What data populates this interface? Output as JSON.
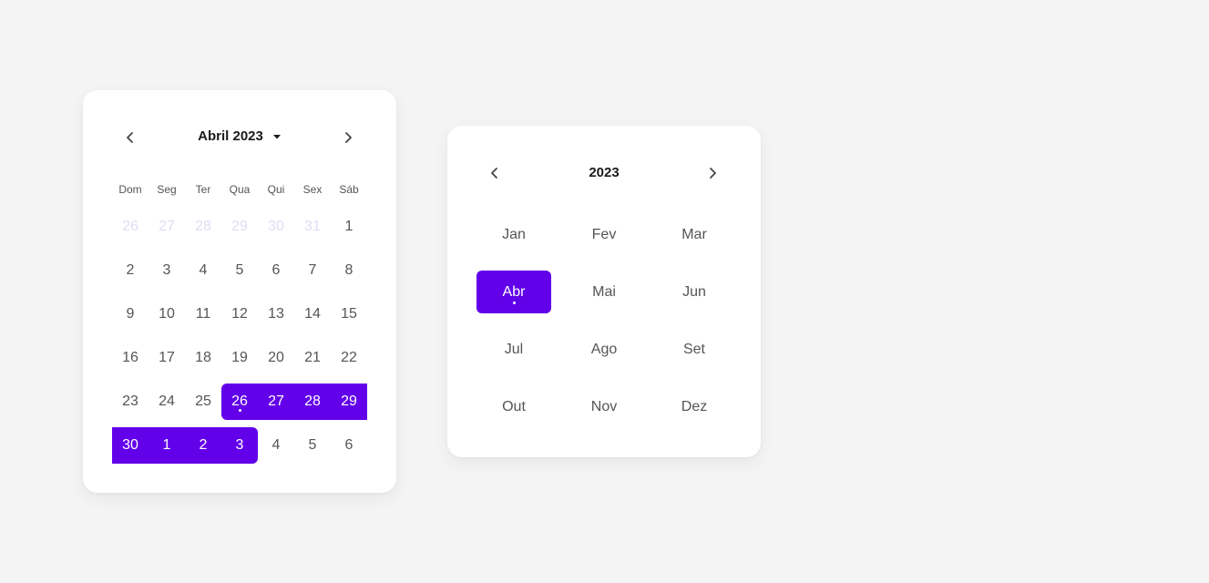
{
  "day_picker": {
    "title": "Abril 2023",
    "weekdays": [
      "Dom",
      "Seg",
      "Ter",
      "Qua",
      "Qui",
      "Sex",
      "Sáb"
    ],
    "days": [
      {
        "label": "26",
        "state": "muted"
      },
      {
        "label": "27",
        "state": "muted"
      },
      {
        "label": "28",
        "state": "muted"
      },
      {
        "label": "29",
        "state": "muted"
      },
      {
        "label": "30",
        "state": "muted"
      },
      {
        "label": "31",
        "state": "muted"
      },
      {
        "label": "1",
        "state": "normal"
      },
      {
        "label": "2",
        "state": "normal"
      },
      {
        "label": "3",
        "state": "normal"
      },
      {
        "label": "4",
        "state": "normal"
      },
      {
        "label": "5",
        "state": "normal"
      },
      {
        "label": "6",
        "state": "normal"
      },
      {
        "label": "7",
        "state": "normal"
      },
      {
        "label": "8",
        "state": "normal"
      },
      {
        "label": "9",
        "state": "normal"
      },
      {
        "label": "10",
        "state": "normal"
      },
      {
        "label": "11",
        "state": "normal"
      },
      {
        "label": "12",
        "state": "normal"
      },
      {
        "label": "13",
        "state": "normal"
      },
      {
        "label": "14",
        "state": "normal"
      },
      {
        "label": "15",
        "state": "normal"
      },
      {
        "label": "16",
        "state": "normal"
      },
      {
        "label": "17",
        "state": "normal"
      },
      {
        "label": "18",
        "state": "normal"
      },
      {
        "label": "19",
        "state": "normal"
      },
      {
        "label": "20",
        "state": "normal"
      },
      {
        "label": "21",
        "state": "normal"
      },
      {
        "label": "22",
        "state": "normal"
      },
      {
        "label": "23",
        "state": "normal"
      },
      {
        "label": "24",
        "state": "normal"
      },
      {
        "label": "25",
        "state": "normal"
      },
      {
        "label": "26",
        "state": "range-start",
        "today": true
      },
      {
        "label": "27",
        "state": "range"
      },
      {
        "label": "28",
        "state": "range"
      },
      {
        "label": "29",
        "state": "range"
      },
      {
        "label": "30",
        "state": "range"
      },
      {
        "label": "1",
        "state": "range"
      },
      {
        "label": "2",
        "state": "range"
      },
      {
        "label": "3",
        "state": "range-end"
      },
      {
        "label": "4",
        "state": "normal"
      },
      {
        "label": "5",
        "state": "normal"
      },
      {
        "label": "6",
        "state": "normal"
      }
    ]
  },
  "month_picker": {
    "year": "2023",
    "months": [
      {
        "label": "Jan",
        "selected": false
      },
      {
        "label": "Fev",
        "selected": false
      },
      {
        "label": "Mar",
        "selected": false
      },
      {
        "label": "Abr",
        "selected": true
      },
      {
        "label": "Mai",
        "selected": false
      },
      {
        "label": "Jun",
        "selected": false
      },
      {
        "label": "Jul",
        "selected": false
      },
      {
        "label": "Ago",
        "selected": false
      },
      {
        "label": "Set",
        "selected": false
      },
      {
        "label": "Out",
        "selected": false
      },
      {
        "label": "Nov",
        "selected": false
      },
      {
        "label": "Dez",
        "selected": false
      }
    ]
  },
  "colors": {
    "accent": "#6200ea",
    "text": "#555555",
    "muted": "#e2dcf5",
    "background": "#f4f4f4"
  },
  "icons": {
    "prev": "chevron-left-icon",
    "next": "chevron-right-icon",
    "dropdown": "caret-down-icon"
  }
}
